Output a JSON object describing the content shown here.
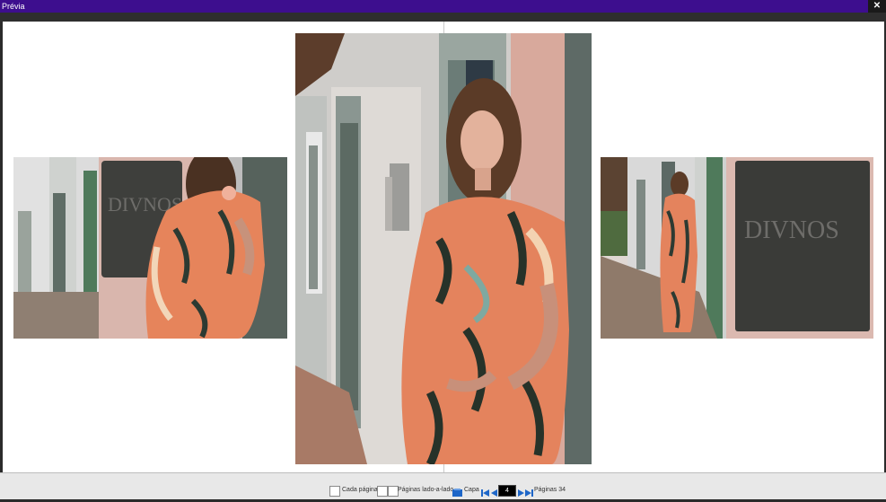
{
  "window": {
    "title": "Prévia",
    "close_label": "✕"
  },
  "toolbar": {
    "cada_pagina": "Cada página",
    "paginas_lado": "Páginas lado-a-lado",
    "capa": "Capa",
    "page_value": "4",
    "paginas_label": "Páginas 34"
  },
  "colors": {
    "titlebar": "#3d0e8e",
    "nav_accent": "#1e66c8"
  }
}
